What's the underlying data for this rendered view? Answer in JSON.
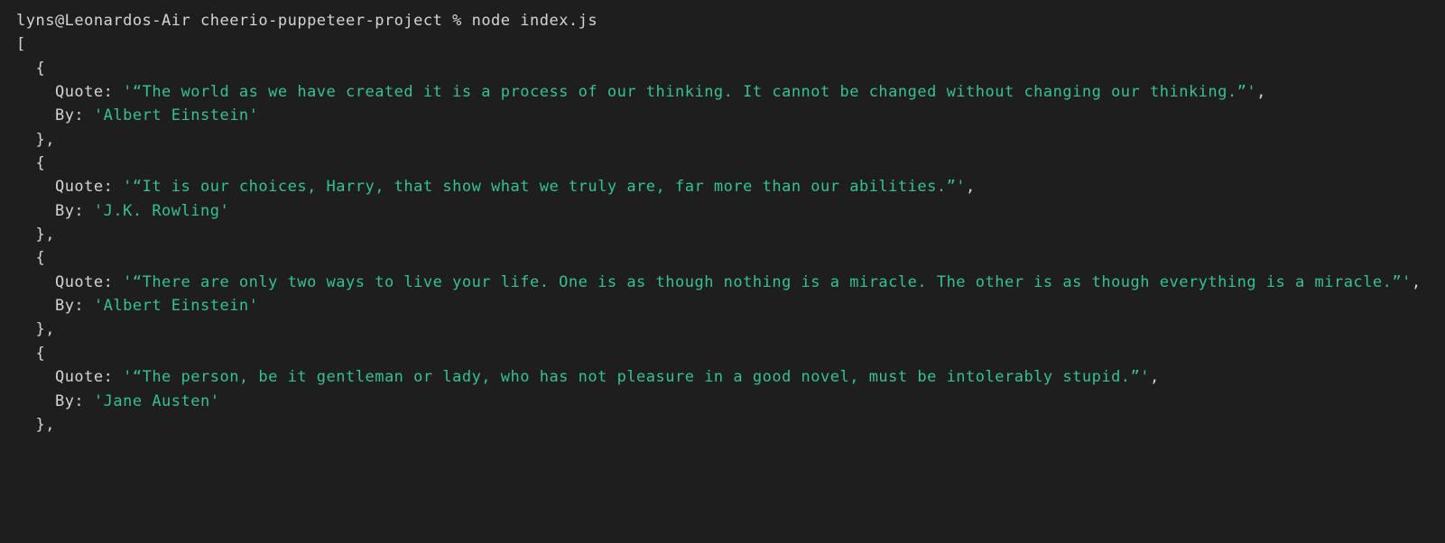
{
  "prompt_user": "lyns@Leonardos-Air",
  "prompt_dir": "cheerio-puppeteer-project",
  "prompt_sep": " % ",
  "command": "node index.js",
  "open_array": "[",
  "indent_obj_open": "  {",
  "indent_obj_close": "  },",
  "key_quote": "    Quote: ",
  "key_by": "    By: ",
  "entries": [
    {
      "quote": "'“The world as we have created it is a process of our thinking. It cannot be changed without changing our thinking.”'",
      "by": "'Albert Einstein'"
    },
    {
      "quote": "'“It is our choices, Harry, that show what we truly are, far more than our abilities.”'",
      "by": "'J.K. Rowling'"
    },
    {
      "quote": "'“There are only two ways to live your life. One is as though nothing is a miracle. The other is as though everything is a miracle.”'",
      "by": "'Albert Einstein'"
    },
    {
      "quote": "'“The person, be it gentleman or lady, who has not pleasure in a good novel, must be intolerably stupid.”'",
      "by": "'Jane Austen'"
    }
  ],
  "comma": ",",
  "colors": {
    "background": "#1e1e1e",
    "text": "#d4d4d4",
    "string": "#35c28f"
  }
}
